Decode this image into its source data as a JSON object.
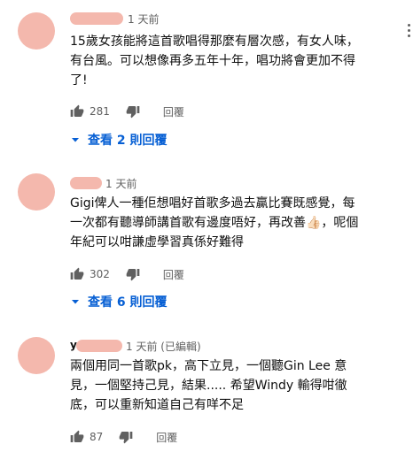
{
  "colors": {
    "link": "#065fd4",
    "meta": "#606060",
    "avatar": "#f4b8ad"
  },
  "comments": [
    {
      "meta": "1 天前",
      "lines": [
        "15歲女孩能將這首歌唱得那麼有層次感，有女人味，",
        "有台風。可以想像再多五年十年，唱功將會更加不得",
        "了!"
      ],
      "likes": "281",
      "reply_label": "回覆",
      "replies_toggle": "查看 2 則回覆"
    },
    {
      "meta": "1 天前",
      "lines": [
        "Gigi俾人一種佢想唱好首歌多過去贏比賽既感覺，每",
        "一次都有聽導師講首歌有邊度唔好，再改善👍🏻，呢個",
        "年紀可以咁謙虛學習真係好難得"
      ],
      "likes": "302",
      "reply_label": "回覆",
      "replies_toggle": "查看 6 則回覆"
    },
    {
      "name_prefix": "y",
      "meta": "1 天前 (已編輯)",
      "lines": [
        "兩個用同一首歌pk，高下立見，一個聽Gin Lee 意",
        "見，一個堅持己見，結果..... 希望Windy 輸得咁徹",
        "底，可以重新知道自己有咩不足"
      ],
      "likes": "87",
      "reply_label": "回覆"
    }
  ]
}
